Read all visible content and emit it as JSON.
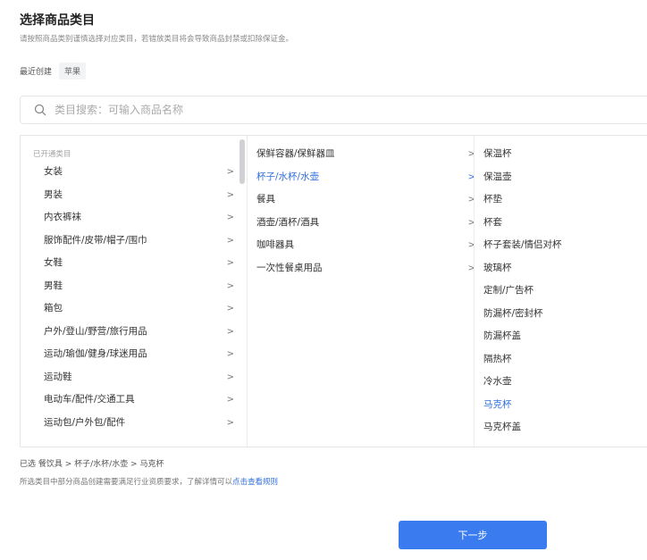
{
  "header": {
    "title": "选择商品类目",
    "description": "请按照商品类别谨慎选择对应类目，若错放类目将会导致商品封禁或扣除保证金。"
  },
  "recent": {
    "label": "最近创建",
    "tag": "苹果"
  },
  "search": {
    "placeholder": "类目搜索：可输入商品名称",
    "value": ""
  },
  "columns": {
    "col1": {
      "header": "已开通类目",
      "items": [
        {
          "label": "女装"
        },
        {
          "label": "男装"
        },
        {
          "label": "内衣裤袜"
        },
        {
          "label": "服饰配件/皮带/帽子/围巾"
        },
        {
          "label": "女鞋"
        },
        {
          "label": "男鞋"
        },
        {
          "label": "箱包"
        },
        {
          "label": "户外/登山/野营/旅行用品"
        },
        {
          "label": "运动/瑜伽/健身/球迷用品"
        },
        {
          "label": "运动鞋"
        },
        {
          "label": "电动车/配件/交通工具"
        },
        {
          "label": "运动包/户外包/配件"
        }
      ]
    },
    "col2": {
      "items": [
        {
          "label": "保鲜容器/保鲜器皿"
        },
        {
          "label": "杯子/水杯/水壶",
          "active": true
        },
        {
          "label": "餐具"
        },
        {
          "label": "酒壶/酒杯/酒具"
        },
        {
          "label": "咖啡器具"
        },
        {
          "label": "一次性餐桌用品"
        }
      ]
    },
    "col3": {
      "items": [
        {
          "label": "保温杯"
        },
        {
          "label": "保温壶"
        },
        {
          "label": "杯垫"
        },
        {
          "label": "杯套"
        },
        {
          "label": "杯子套装/情侣对杯"
        },
        {
          "label": "玻璃杯"
        },
        {
          "label": "定制/广告杯"
        },
        {
          "label": "防漏杯/密封杯"
        },
        {
          "label": "防漏杯盖"
        },
        {
          "label": "隔热杯"
        },
        {
          "label": "冷水壶"
        },
        {
          "label": "马克杯",
          "active": true
        },
        {
          "label": "马克杯盖"
        }
      ]
    }
  },
  "chevron": ">",
  "selection": {
    "text": "已选  餐饮具 > 杯子/水杯/水壶 > 马克杯"
  },
  "note": {
    "text": "所选类目中部分商品创建需要满足行业资质要求，了解详情可以",
    "link": "点击查看规则"
  },
  "footer": {
    "next_label": "下一步"
  },
  "colors": {
    "accent": "#2f6fdc",
    "button": "#3a7bf0"
  },
  "icons": {
    "search": "search-icon",
    "chevron": "chevron-right-icon"
  }
}
